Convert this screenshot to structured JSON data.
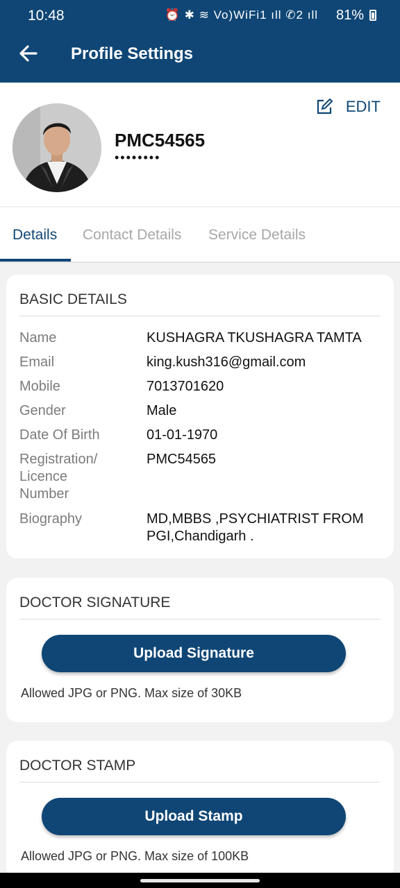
{
  "status_bar": {
    "time": "10:48",
    "icons": "⏰ ✱ ≋ Vo)WiFi1 ıll ✆2 ıll",
    "battery": "81%"
  },
  "app_bar": {
    "title": "Profile Settings",
    "back_icon": "arrow-left-icon"
  },
  "profile": {
    "id": "PMC54565",
    "password_mask": "••••••••",
    "edit_label": "EDIT",
    "edit_icon": "edit-icon"
  },
  "tabs": [
    {
      "label": "Details",
      "active": true
    },
    {
      "label": "Contact Details",
      "active": false
    },
    {
      "label": "Service Details",
      "active": false
    }
  ],
  "basic_details": {
    "title": "BASIC DETAILS",
    "rows": [
      {
        "label": "Name",
        "value": "KUSHAGRA TKUSHAGRA  TAMTA"
      },
      {
        "label": "Email",
        "value": "king.kush316@gmail.com"
      },
      {
        "label": "Mobile",
        "value": "7013701620"
      },
      {
        "label": "Gender",
        "value": "Male"
      },
      {
        "label": "Date Of Birth",
        "value": "01-01-1970"
      },
      {
        "label": "Registration/ Licence Number",
        "value": "PMC54565"
      },
      {
        "label": "Biography",
        "value": "MD,MBBS ,PSYCHIATRIST FROM PGI,Chandigarh ."
      }
    ]
  },
  "signature": {
    "title": "DOCTOR SIGNATURE",
    "button": "Upload Signature",
    "note": "Allowed JPG or PNG. Max size of 30KB"
  },
  "stamp": {
    "title": "DOCTOR STAMP",
    "button": "Upload Stamp",
    "note": "Allowed JPG or PNG. Max size of 100KB"
  },
  "colors": {
    "primary": "#0f4675",
    "background": "#f2f2f2",
    "muted": "#a7a7a7"
  }
}
